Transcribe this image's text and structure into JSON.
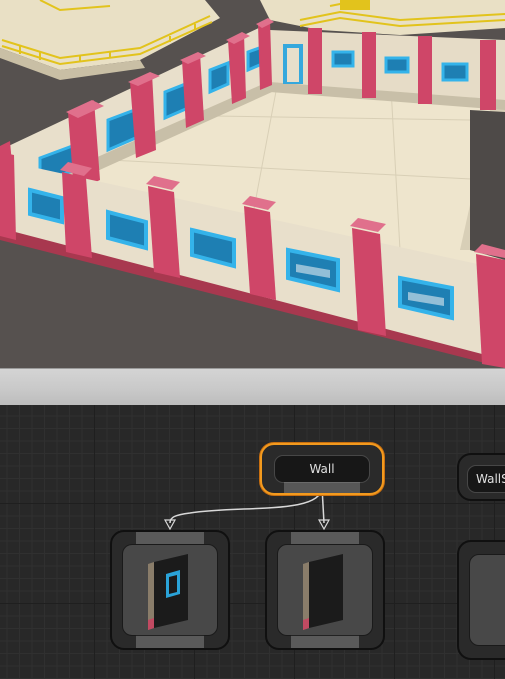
{
  "scene_view": {
    "colors": {
      "ground": "#54504e",
      "floor": "#ece4cc",
      "wall": "#e8dfcb",
      "pillar": "#d24a6b",
      "window_frame": "#2aa3d8",
      "rail": "#e6c61a"
    }
  },
  "graph": {
    "nodes": {
      "wall": {
        "title": "Wall",
        "state": "selected"
      },
      "wall_s": {
        "title": "WallS"
      }
    },
    "assets": [
      {
        "name": "wall-window-asset",
        "icon": "wall-with-window"
      },
      {
        "name": "wall-plain-asset",
        "icon": "plain-wall"
      }
    ],
    "colors": {
      "selection": "#f39a1e",
      "edge": "#d8d8d8"
    }
  }
}
